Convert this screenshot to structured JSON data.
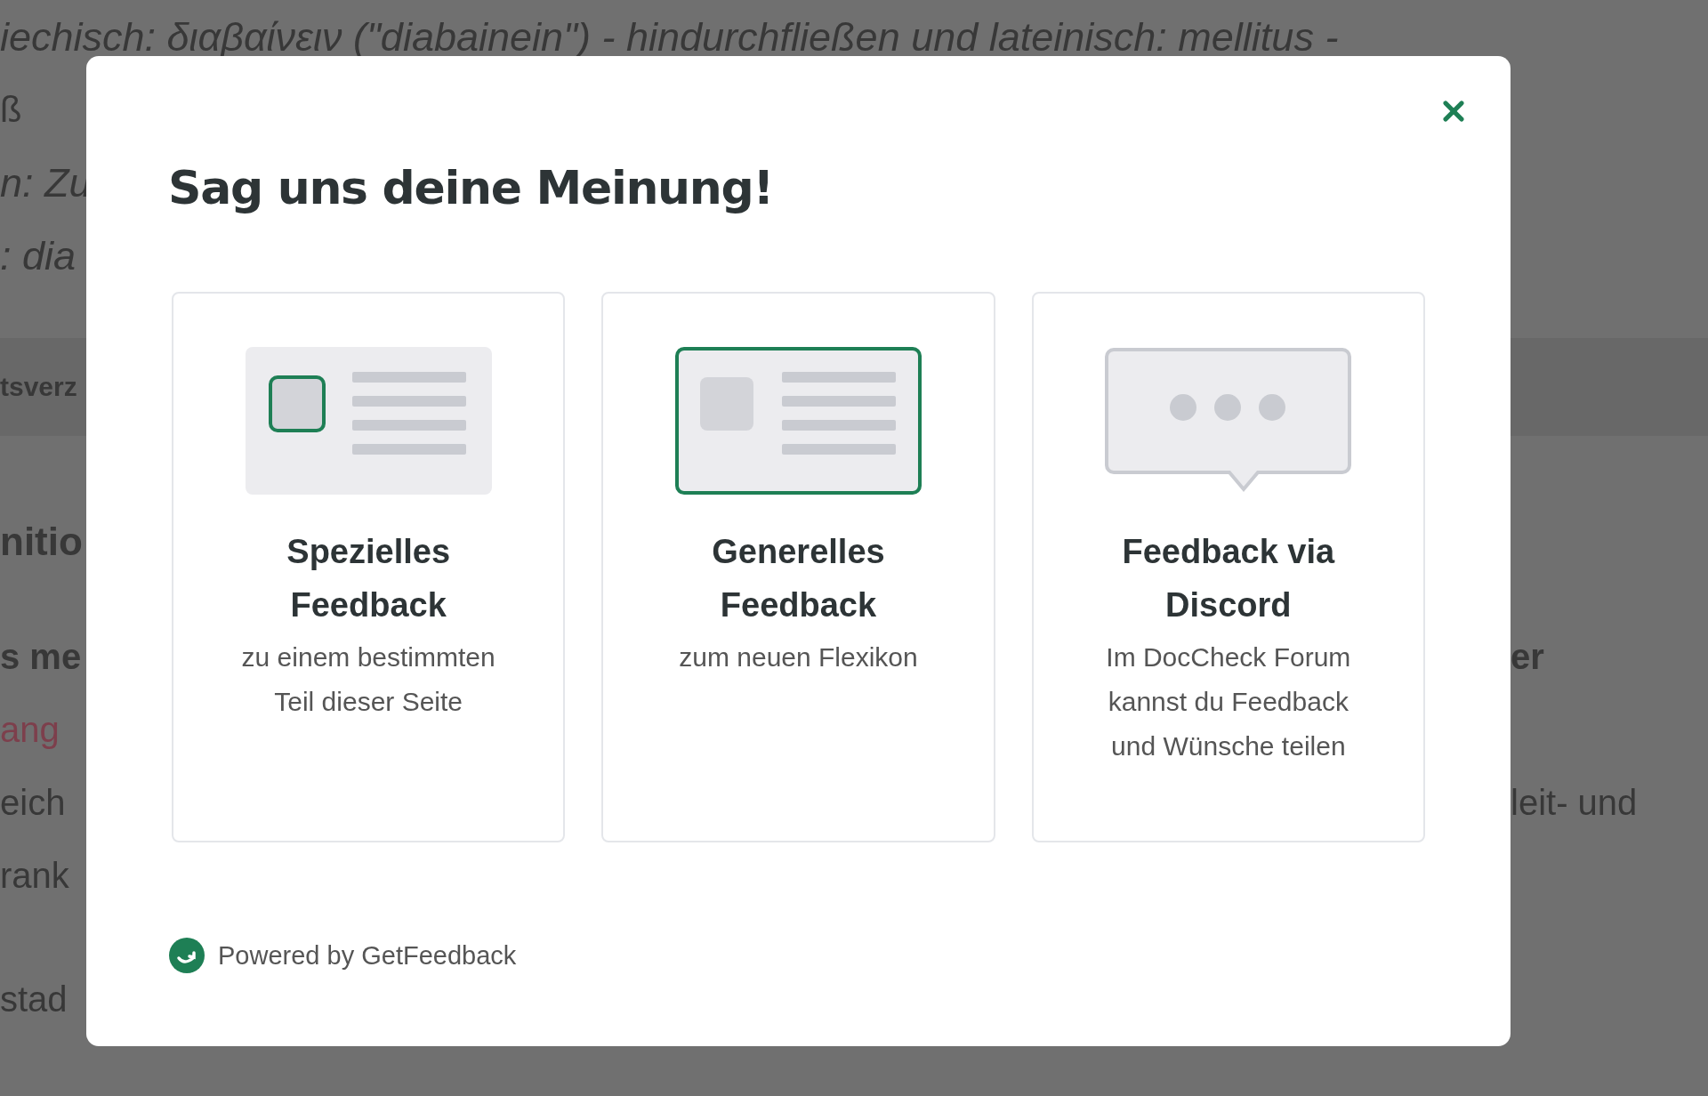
{
  "background": {
    "lines": [
      {
        "kind": "italic",
        "left": "iechisch: διαβαίνειν (\"diabainein\") - hindurchfließen und lateinisch: mellitus -"
      },
      {
        "kind": "plain",
        "left": "ß"
      },
      {
        "kind": "italic",
        "left": "n: Zu"
      },
      {
        "kind": "italic",
        "left": ": dia"
      },
      {
        "kind": "band",
        "left": "tsverz"
      },
      {
        "kind": "heading",
        "left": "nitio"
      },
      {
        "kind": "bold",
        "left": "s me",
        "right": "er"
      },
      {
        "kind": "link",
        "left": "ang"
      },
      {
        "kind": "plain",
        "left": "eich",
        "right": "leit- und"
      },
      {
        "kind": "plain",
        "left": "rank"
      },
      {
        "kind": "paragraph",
        "left": "stad"
      }
    ]
  },
  "modal": {
    "title": "Sag uns deine Meinung!",
    "options": [
      {
        "kind": "section",
        "heading": "Spezielles Feedback",
        "description": "zu einem bestimmten Teil dieser Seite"
      },
      {
        "kind": "general",
        "heading": "Generelles Feedback",
        "description": "zum neuen Flexikon"
      },
      {
        "kind": "chat",
        "heading": "Feedback via Discord",
        "description": "Im DocCheck Forum kannst du Feedback und Wünsche teilen"
      }
    ],
    "footer": "Powered by GetFeedback"
  }
}
